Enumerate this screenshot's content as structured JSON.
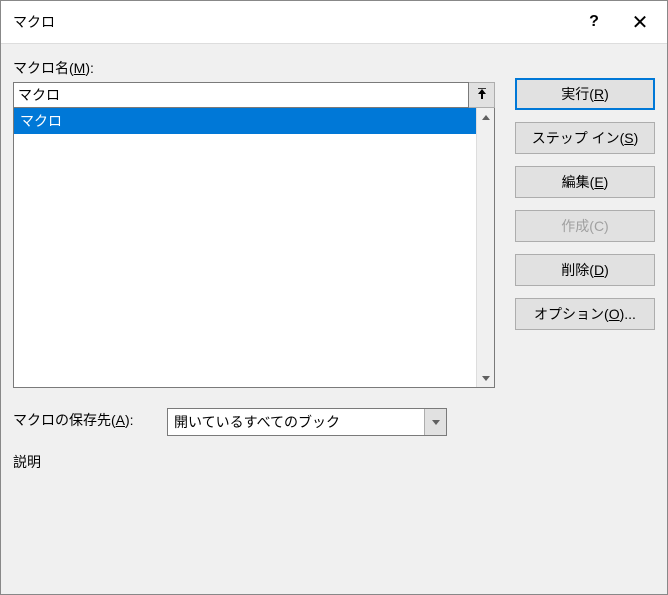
{
  "titlebar": {
    "title": "マクロ",
    "help": "?",
    "close": "✕"
  },
  "labels": {
    "macro_name": "マクロ名(",
    "macro_name_key": "M",
    "macro_name_end": "):",
    "save_location": "マクロの保存先(",
    "save_location_key": "A",
    "save_location_end": "):",
    "description": "説明"
  },
  "input": {
    "value": "マクロ"
  },
  "list": {
    "items": [
      "マクロ"
    ],
    "selected_index": 0
  },
  "buttons": {
    "run": "実行(",
    "run_key": "R",
    "run_end": ")",
    "step_in": "ステップ イン(",
    "step_in_key": "S",
    "step_in_end": ")",
    "edit": "編集(",
    "edit_key": "E",
    "edit_end": ")",
    "create": "作成(C)",
    "delete": "削除(",
    "delete_key": "D",
    "delete_end": ")",
    "options": "オプション(",
    "options_key": "O",
    "options_end": ")..."
  },
  "select": {
    "value": "開いているすべてのブック"
  }
}
